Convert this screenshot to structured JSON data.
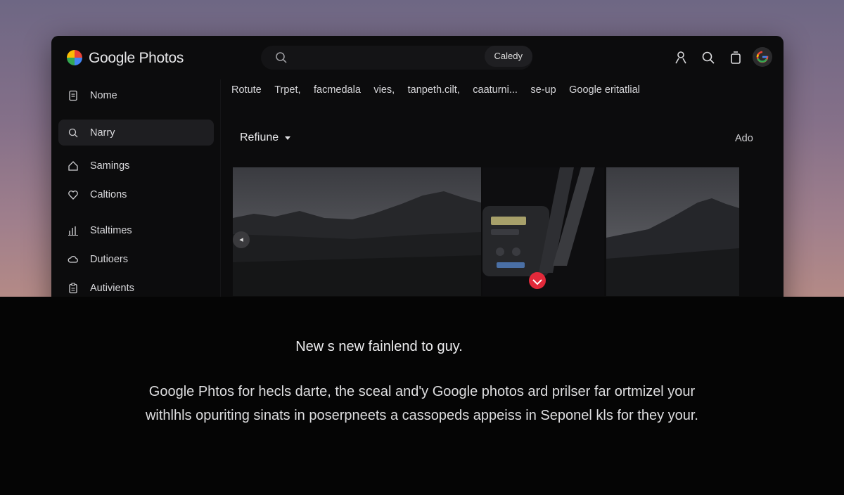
{
  "app": {
    "title": "Google Photos"
  },
  "search": {
    "placeholder": "",
    "chip_label": "Caledy"
  },
  "header_icons": [
    "person-icon",
    "search-icon",
    "trash-icon",
    "account-avatar"
  ],
  "sidebar": {
    "items": [
      {
        "label": "Nome",
        "icon": "document-icon",
        "active": false
      },
      {
        "label": "Narry",
        "icon": "search-icon",
        "active": true
      },
      {
        "label": "Samings",
        "icon": "share-icon",
        "active": false
      },
      {
        "label": "Caltions",
        "icon": "heart-icon",
        "active": false
      },
      {
        "label": "Staltimes",
        "icon": "bars-icon",
        "active": false
      },
      {
        "label": "Dutioers",
        "icon": "cloud-icon",
        "active": false
      },
      {
        "label": "Autivients",
        "icon": "clipboard-icon",
        "active": false
      }
    ]
  },
  "filters": [
    "Rotute",
    "Trpet,",
    "facmedala",
    "vies,",
    "tanpeth.cilt,",
    "caaturni...",
    "se-up",
    "Google eritatlial"
  ],
  "section": {
    "title": "Refiune",
    "action": "Ado"
  },
  "photos": [
    {
      "subject": "mountain-landscape"
    },
    {
      "subject": "camera-equipment"
    },
    {
      "subject": "mountain-landscape"
    }
  ],
  "promo": {
    "headline": "New s new fainlend to guy.",
    "line1": "Google Phtos for hecls darte, the sceal and'y Google photos ard prilser far ortmizel your",
    "line2": "withlhls opuriting sinats in poserpneets a cassopeds appeiss in Seponel kls for they your."
  },
  "colors": {
    "window_bg": "#0c0c0d",
    "active_nav": "#1e1e21",
    "record_button": "#e2293a"
  }
}
